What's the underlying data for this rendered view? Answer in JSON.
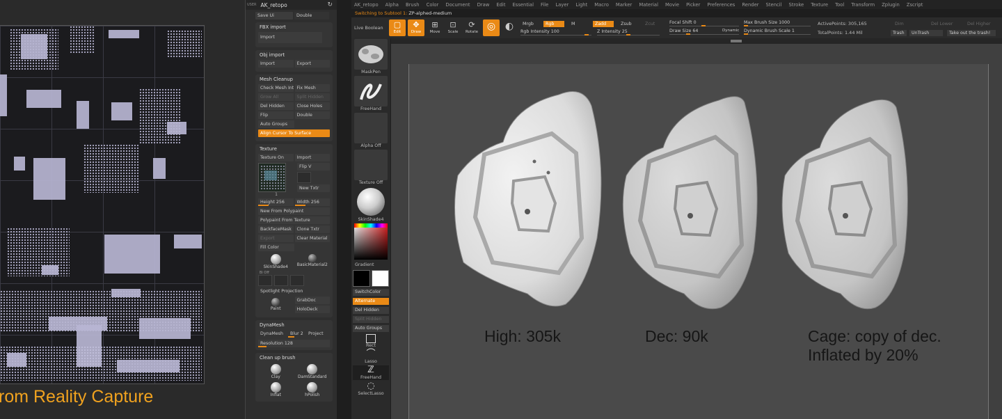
{
  "texture_viewer": {
    "caption": "rom Reality Capture"
  },
  "palette": {
    "user_label": "USER",
    "project_title": "AK_retopo",
    "save_ui": "Save Ui",
    "double": "Double",
    "fbx_import": {
      "title": "FBX import",
      "import": "Import"
    },
    "obj_import": {
      "title": "Obj import",
      "import": "Import",
      "export": "Export"
    },
    "mesh_cleanup": {
      "title": "Mesh Cleanup",
      "check_mesh_int": "Check Mesh Int",
      "fix_mesh": "Fix Mesh",
      "grow_all": "Grow All",
      "split_hidden": "Split Hidden",
      "del_hidden": "Del Hidden",
      "close_holes": "Close Holes",
      "flip": "Flip",
      "double": "Double",
      "auto_groups": "Auto Groups",
      "align_cursor": "Align Cursor To Surface"
    },
    "texture": {
      "title": "Texture",
      "texture_on": "Texture On",
      "import": "Import",
      "flip_v": "Flip V",
      "new_txtr": "New Txtr",
      "thumb_index": "1",
      "height_label": "Height",
      "height_value": "256",
      "width_label": "Width",
      "width_value": "256",
      "new_from_polypaint": "New From Polypaint",
      "polypaint_from_texture": "Polypaint From Texture",
      "backface_mask": "BackfaceMask",
      "clone_txtr": "Clone Txtr",
      "export": "Export",
      "clear_material": "Clear Material",
      "fill_color": "Fill Color",
      "mat1": "SkinShade4",
      "mat2": "BasicMaterial2",
      "mini_label": "Bi   Off",
      "spotlight": "Spotlight Projection",
      "paint": "Paint",
      "grabdoc": "GrabDoc",
      "holodeck": "HoloDeck"
    },
    "dynamesh": {
      "title": "DynaMesh",
      "dynamesh": "DynaMesh",
      "blur": "Blur",
      "blur_value": "2",
      "project": "Project",
      "resolution_label": "Resolution",
      "resolution_value": "128"
    },
    "cleanup_brush": {
      "title": "Clean up brush",
      "clay": "Clay",
      "damstandard": "DamStandard",
      "inflat": "Inflat",
      "hpolish": "hPolish"
    }
  },
  "shelf": {
    "maskpen": "MaskPen",
    "freehand": "FreeHand",
    "alpha_off": "Alpha Off",
    "texture_off": "Texture Off",
    "skinshade": "SkinShade4",
    "gradient": "Gradient",
    "switchcolor": "SwitchColor",
    "alternate": "Alternate",
    "del_hidden": "Del Hidden",
    "split_hidden": "Split Hidden",
    "auto_groups": "Auto Groups",
    "rect": "Rect",
    "lasso": "Lasso",
    "freehand2": "FreeHand",
    "selectlasso": "SelectLasso"
  },
  "menubar": {
    "items": [
      "AK_retopo",
      "Alpha",
      "Brush",
      "Color",
      "Document",
      "Draw",
      "Edit",
      "Essential",
      "File",
      "Layer",
      "Light",
      "Macro",
      "Marker",
      "Material",
      "Movie",
      "Picker",
      "Preferences",
      "Render",
      "Stencil",
      "Stroke",
      "Texture",
      "Tool",
      "Transform",
      "Zplugin",
      "Zscript"
    ]
  },
  "status": {
    "prefix": "Switching to Subtool 1:",
    "subtool": "ZP-alphed-medium"
  },
  "toolbar": {
    "live_boolean": "Live Boolean",
    "edit": "Edit",
    "draw": "Draw",
    "move": "Move",
    "scale": "Scale",
    "rotate": "Rotate",
    "mrgb": "Mrgb",
    "rgb": "Rgb",
    "m": "M",
    "rgb_intensity_label": "Rgb Intensity",
    "rgb_intensity_value": "100",
    "zadd": "Zadd",
    "zsub": "Zsub",
    "zcut": "Zcut",
    "z_intensity_label": "Z Intensity",
    "z_intensity_value": "25",
    "focal_shift_label": "Focal Shift",
    "focal_shift_value": "0",
    "draw_size_label": "Draw Size",
    "draw_size_value": "64",
    "dynamic": "Dynamic",
    "max_brush_size_label": "Max Brush Size",
    "max_brush_size_value": "1000",
    "dynamic_brush_scale_label": "Dynamic Brush Scale",
    "dynamic_brush_scale_value": "1",
    "active_points_label": "ActivePoints:",
    "active_points_value": "305,165",
    "total_points_label": "TotalPoints:",
    "total_points_value": "1.44 Mil",
    "dim_1": "Dim",
    "del_lower": "Del Lower",
    "del_higher": "Del Higher",
    "trash": "Trash",
    "untrash": "UnTrash",
    "take_out_trash": "Take out the trash!"
  },
  "viewport": {
    "label_high": "High: 305k",
    "label_dec": "Dec: 90k",
    "label_cage_line1": "Cage: copy of dec.",
    "label_cage_line2": "Inflated by 20%"
  }
}
